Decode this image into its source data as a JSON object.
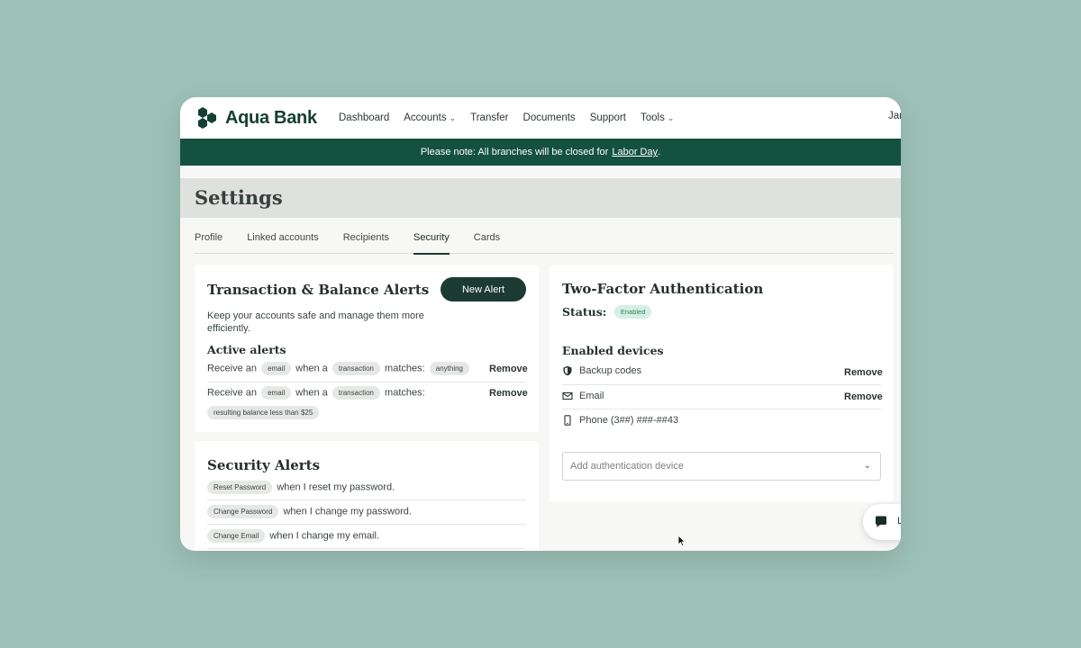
{
  "brand": {
    "name": "Aqua Bank",
    "color": "#143f33"
  },
  "nav": {
    "items": [
      {
        "label": "Dashboard",
        "dropdown": false
      },
      {
        "label": "Accounts",
        "dropdown": true
      },
      {
        "label": "Transfer",
        "dropdown": false
      },
      {
        "label": "Documents",
        "dropdown": false
      },
      {
        "label": "Support",
        "dropdown": false
      },
      {
        "label": "Tools",
        "dropdown": true
      }
    ],
    "user_partial": "Jar"
  },
  "banner": {
    "text": "Please note: All branches will be closed for",
    "link": "Labor Day",
    "suffix": ".",
    "color": "#14513f"
  },
  "page": {
    "title": "Settings"
  },
  "tabs": [
    {
      "label": "Profile",
      "active": false
    },
    {
      "label": "Linked accounts",
      "active": false
    },
    {
      "label": "Recipients",
      "active": false
    },
    {
      "label": "Security",
      "active": true
    },
    {
      "label": "Cards",
      "active": false
    }
  ],
  "transaction_alerts": {
    "title": "Transaction & Balance Alerts",
    "new_button": "New Alert",
    "description": "Keep your accounts safe and manage them more efficiently.",
    "active_heading": "Active alerts",
    "alerts": [
      {
        "prefix": "Receive an",
        "channel": "email",
        "mid": "when a",
        "type": "transaction",
        "suffix": "matches:",
        "condition": "anything",
        "action": "Remove"
      },
      {
        "prefix": "Receive an",
        "channel": "email",
        "mid": "when a",
        "type": "transaction",
        "suffix": "matches:",
        "condition": "resulting balance less than $25",
        "action": "Remove"
      }
    ]
  },
  "security_alerts": {
    "title": "Security Alerts",
    "rows": [
      {
        "chip": "Reset Password",
        "text": "when I reset my password."
      },
      {
        "chip": "Change Password",
        "text": "when I change my password."
      },
      {
        "chip": "Change Email",
        "text": "when I change my email."
      }
    ]
  },
  "two_factor": {
    "title": "Two-Factor Authentication",
    "status_label": "Status:",
    "status_value": "Enabled",
    "devices_heading": "Enabled devices",
    "devices": [
      {
        "icon": "shield-icon",
        "label": "Backup codes",
        "action": "Remove"
      },
      {
        "icon": "mail-icon",
        "label": "Email",
        "action": "Remove"
      },
      {
        "icon": "phone-icon",
        "label": "Phone (3##) ###-##43",
        "action": ""
      }
    ],
    "add_placeholder": "Add authentication device"
  },
  "chat": {
    "label_partial": "L"
  }
}
